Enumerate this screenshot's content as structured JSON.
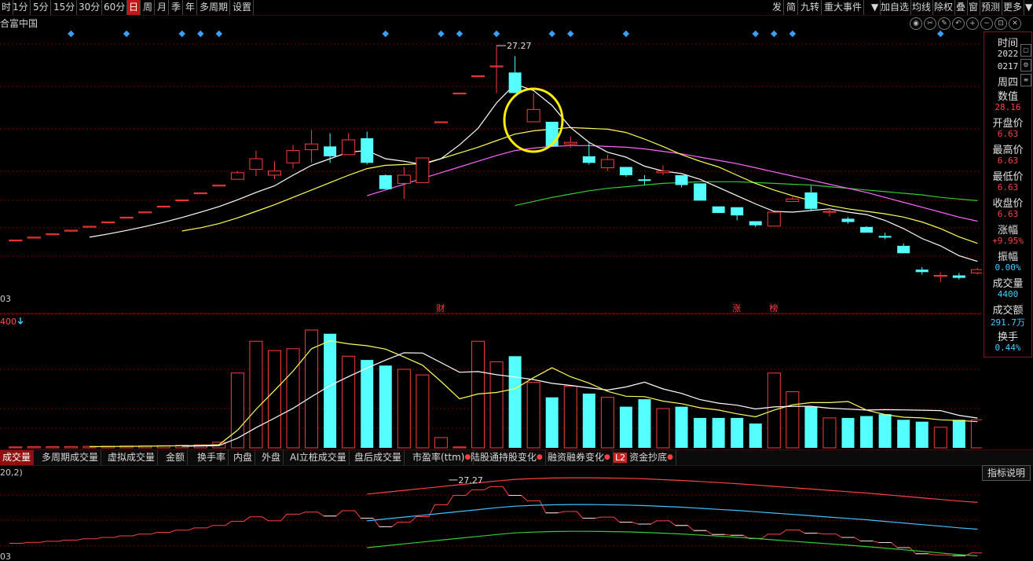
{
  "toolbar": {
    "left_items": [
      "时",
      "1分",
      "5分",
      "15分",
      "30分",
      "60分",
      "日",
      "周",
      "月",
      "季",
      "年",
      "多周期",
      "设置"
    ],
    "active_left": "日",
    "right_items": [
      "发",
      "简",
      "九转",
      "重大事件",
      "▼",
      "加自选",
      "均线",
      "除权",
      "叠",
      "窗",
      "预测",
      "更多",
      "▼"
    ]
  },
  "title": "合富中国",
  "chart": {
    "price_label": "27.27",
    "left_axis_bottom": "03",
    "event_markers": [
      "财",
      "涨",
      "榜"
    ],
    "volume_label": "400",
    "lower_label": "20,2)",
    "lower_price_label": "27.27",
    "lower_axis_bottom": "03"
  },
  "sidepanel": {
    "rows": [
      {
        "label": "时间",
        "value": null
      },
      {
        "label": null,
        "value": "2022",
        "style": "date"
      },
      {
        "label": null,
        "value": "0217",
        "style": "date"
      },
      {
        "label": "周四",
        "value": null
      },
      {
        "label": "数值",
        "value": null
      },
      {
        "label": null,
        "value": "28.16",
        "style": "red"
      },
      {
        "label": "开盘价",
        "value": null
      },
      {
        "label": null,
        "value": "6.63",
        "style": "red"
      },
      {
        "label": "最高价",
        "value": null
      },
      {
        "label": null,
        "value": "6.63",
        "style": "red"
      },
      {
        "label": "最低价",
        "value": null
      },
      {
        "label": null,
        "value": "6.63",
        "style": "red"
      },
      {
        "label": "收盘价",
        "value": null
      },
      {
        "label": null,
        "value": "6.63",
        "style": "red"
      },
      {
        "label": "涨幅",
        "value": null
      },
      {
        "label": null,
        "value": "+9.95%",
        "style": "red"
      },
      {
        "label": "振幅",
        "value": null
      },
      {
        "label": null,
        "value": "0.00%",
        "style": "cyan"
      },
      {
        "label": "成交量",
        "value": null
      },
      {
        "label": null,
        "value": "4400",
        "style": "cyan"
      },
      {
        "label": "成交额",
        "value": null
      },
      {
        "label": null,
        "value": "291.7万",
        "style": "cyan"
      },
      {
        "label": "换手",
        "value": null
      },
      {
        "label": null,
        "value": "0.44%",
        "style": "cyan"
      }
    ]
  },
  "tabs": [
    {
      "label": "成交量",
      "active": true,
      "dot": false
    },
    {
      "label": "多周期成交量",
      "active": false,
      "dot": false
    },
    {
      "label": "虚拟成交量",
      "active": false,
      "dot": false
    },
    {
      "label": "金额",
      "active": false,
      "dot": false
    },
    {
      "label": "换手率",
      "active": false,
      "dot": false
    },
    {
      "label": "内盘",
      "active": false,
      "dot": false
    },
    {
      "label": "外盘",
      "active": false,
      "dot": false
    },
    {
      "label": "AI立桩成交量",
      "active": false,
      "dot": false
    },
    {
      "label": "盘后成交量",
      "active": false,
      "dot": false
    },
    {
      "label": "市盈率(ttm)",
      "active": false,
      "dot": true
    },
    {
      "label": "陆股通持股变化",
      "active": false,
      "dot": true
    },
    {
      "label": "融资融券变化",
      "active": false,
      "dot": true
    },
    {
      "label": "资金抄底",
      "active": false,
      "dot": true,
      "badge": "L2"
    }
  ],
  "explain_button": "指标说明",
  "colors": {
    "up": "#ff3b3b",
    "down": "#54ffff",
    "ma5": "#ffffff",
    "ma10": "#ffff55",
    "ma20": "#ff66ff",
    "ma60": "#33cc33",
    "grid": "#7a0000",
    "highlight": "#ffee00"
  },
  "candles": [
    {
      "o": 3.6,
      "c": 3.6,
      "h": 3.6,
      "l": 3.6
    },
    {
      "o": 3.96,
      "c": 3.96,
      "h": 3.96,
      "l": 3.96
    },
    {
      "o": 4.36,
      "c": 4.36,
      "h": 4.36,
      "l": 4.36
    },
    {
      "o": 4.8,
      "c": 4.8,
      "h": 4.8,
      "l": 4.8
    },
    {
      "o": 5.28,
      "c": 5.28,
      "h": 5.28,
      "l": 5.28
    },
    {
      "o": 5.81,
      "c": 5.81,
      "h": 5.81,
      "l": 5.81
    },
    {
      "o": 6.39,
      "c": 6.39,
      "h": 6.39,
      "l": 6.39
    },
    {
      "o": 7.03,
      "c": 7.03,
      "h": 7.03,
      "l": 7.03
    },
    {
      "o": 7.73,
      "c": 7.73,
      "h": 7.73,
      "l": 7.73
    },
    {
      "o": 8.5,
      "c": 8.5,
      "h": 8.5,
      "l": 8.5
    },
    {
      "o": 9.35,
      "c": 9.35,
      "h": 9.35,
      "l": 9.35
    },
    {
      "o": 10.29,
      "c": 10.29,
      "h": 10.29,
      "l": 10.29
    },
    {
      "o": 11.0,
      "c": 11.8,
      "h": 12.0,
      "l": 11.0
    },
    {
      "o": 12.2,
      "c": 13.5,
      "h": 14.5,
      "l": 11.4
    },
    {
      "o": 11.5,
      "c": 12.0,
      "h": 13.2,
      "l": 11.0
    },
    {
      "o": 13.0,
      "c": 14.5,
      "h": 15.2,
      "l": 12.3
    },
    {
      "o": 14.6,
      "c": 15.3,
      "h": 17.0,
      "l": 13.0
    },
    {
      "o": 15.0,
      "c": 13.8,
      "h": 16.6,
      "l": 13.0
    },
    {
      "o": 14.0,
      "c": 15.8,
      "h": 16.6,
      "l": 14.0
    },
    {
      "o": 16.0,
      "c": 13.0,
      "h": 16.8,
      "l": 12.8
    },
    {
      "o": 11.5,
      "c": 9.8,
      "h": 11.6,
      "l": 9.8
    },
    {
      "o": 10.5,
      "c": 11.5,
      "h": 12.5,
      "l": 8.6
    },
    {
      "o": 10.6,
      "c": 13.6,
      "h": 13.6,
      "l": 10.6
    },
    {
      "o": 18.0,
      "c": 18.0,
      "h": 18.0,
      "l": 18.0
    },
    {
      "o": 21.5,
      "c": 21.5,
      "h": 21.5,
      "l": 21.5
    },
    {
      "o": 23.6,
      "c": 23.6,
      "h": 23.6,
      "l": 23.6
    },
    {
      "o": 24.8,
      "c": 24.8,
      "h": 27.27,
      "l": 21.5
    },
    {
      "o": 24.0,
      "c": 21.5,
      "h": 26.0,
      "l": 21.5
    },
    {
      "o": 18.0,
      "c": 19.5,
      "h": 21.5,
      "l": 18.0
    },
    {
      "o": 18.0,
      "c": 15.0,
      "h": 18.0,
      "l": 15.0
    },
    {
      "o": 15.3,
      "c": 15.5,
      "h": 16.2,
      "l": 14.8
    },
    {
      "o": 13.8,
      "c": 13.0,
      "h": 15.5,
      "l": 12.8
    },
    {
      "o": 12.4,
      "c": 13.4,
      "h": 14.0,
      "l": 12.0
    },
    {
      "o": 12.5,
      "c": 11.5,
      "h": 12.5,
      "l": 11.3
    },
    {
      "o": 11.0,
      "c": 10.8,
      "h": 11.5,
      "l": 10.3
    },
    {
      "o": 11.8,
      "c": 12.0,
      "h": 12.7,
      "l": 11.5
    },
    {
      "o": 11.5,
      "c": 10.3,
      "h": 11.5,
      "l": 10.0
    },
    {
      "o": 10.5,
      "c": 8.4,
      "h": 10.5,
      "l": 8.4
    },
    {
      "o": 7.7,
      "c": 6.9,
      "h": 7.7,
      "l": 6.9
    },
    {
      "o": 7.6,
      "c": 6.6,
      "h": 7.6,
      "l": 6.0
    },
    {
      "o": 5.9,
      "c": 5.4,
      "h": 5.9,
      "l": 5.2
    },
    {
      "o": 5.3,
      "c": 7.0,
      "h": 7.0,
      "l": 5.3
    },
    {
      "o": 8.3,
      "c": 8.6,
      "h": 9.0,
      "l": 8.3
    },
    {
      "o": 9.4,
      "c": 7.4,
      "h": 10.2,
      "l": 7.2
    },
    {
      "o": 7.1,
      "c": 7.1,
      "h": 7.4,
      "l": 6.5
    },
    {
      "o": 6.2,
      "c": 5.8,
      "h": 6.4,
      "l": 5.6
    },
    {
      "o": 5.2,
      "c": 4.5,
      "h": 5.3,
      "l": 4.5
    },
    {
      "o": 4.1,
      "c": 3.9,
      "h": 4.5,
      "l": 3.7
    },
    {
      "o": 2.9,
      "c": 2.0,
      "h": 3.2,
      "l": 2.0
    },
    {
      "o": 0.0,
      "c": -0.3,
      "h": 0.3,
      "l": -0.6
    },
    {
      "o": -0.7,
      "c": -0.7,
      "h": -0.3,
      "l": -1.5
    },
    {
      "o": -0.7,
      "c": -1.0,
      "h": -0.4,
      "l": -1.2
    },
    {
      "o": -0.4,
      "c": 0.0,
      "h": 0.2,
      "l": -0.6
    }
  ],
  "volumes": [
    0.5,
    0.6,
    0.6,
    0.7,
    0.8,
    0.9,
    1.0,
    1.1,
    1.2,
    1.4,
    1.6,
    3.0,
    40.0,
    57.0,
    52.0,
    53.0,
    63.0,
    61.0,
    49.0,
    47.0,
    44.0,
    42.0,
    39.0,
    5.5,
    0.5,
    57.0,
    46.0,
    49.0,
    35.0,
    27.0,
    33.0,
    29.0,
    27.0,
    22.0,
    26.0,
    21.0,
    22.0,
    16.0,
    16.0,
    16.0,
    13.0,
    40.0,
    30.0,
    22.0,
    16.0,
    16.0,
    17.0,
    18.0,
    15.0,
    14.0,
    11.0,
    15.0,
    15.0
  ],
  "ma_lines": {
    "ma5": [
      null,
      null,
      null,
      null,
      3.95,
      4.34,
      4.77,
      5.25,
      5.77,
      6.35,
      6.99,
      7.68,
      8.5,
      9.4,
      10.2,
      11.5,
      12.7,
      13.5,
      14.3,
      14.5,
      13.5,
      13.2,
      12.8,
      13.5,
      15.2,
      17.2,
      20.3,
      22.6,
      21.8,
      20.0,
      17.3,
      15.5,
      14.3,
      13.7,
      12.6,
      12.0,
      11.7,
      11.0,
      10.0,
      9.0,
      8.0,
      7.1,
      7.0,
      7.2,
      7.4,
      7.0,
      6.7,
      6.0,
      5.0,
      3.8,
      2.9,
      1.7,
      1.0
    ],
    "ma10": [
      null,
      null,
      null,
      null,
      null,
      null,
      null,
      null,
      null,
      4.7,
      5.1,
      5.6,
      6.3,
      7.1,
      7.9,
      8.8,
      9.7,
      10.6,
      11.5,
      12.3,
      12.7,
      12.8,
      12.9,
      13.5,
      14.2,
      14.9,
      15.7,
      16.5,
      16.9,
      17.1,
      17.3,
      17.2,
      17.1,
      16.7,
      15.9,
      15.0,
      14.0,
      13.2,
      12.5,
      11.5,
      10.5,
      9.7,
      9.0,
      8.4,
      7.8,
      7.4,
      7.1,
      6.8,
      6.4,
      5.8,
      5.0,
      4.0,
      3.2
    ],
    "ma20": [
      null,
      null,
      null,
      null,
      null,
      null,
      null,
      null,
      null,
      null,
      null,
      null,
      null,
      null,
      null,
      null,
      null,
      null,
      null,
      9.0,
      9.7,
      10.4,
      11.1,
      11.8,
      12.5,
      13.2,
      13.9,
      14.5,
      14.8,
      15.0,
      15.1,
      15.1,
      15.0,
      14.9,
      14.7,
      14.4,
      14.1,
      13.7,
      13.3,
      12.9,
      12.4,
      11.9,
      11.4,
      10.9,
      10.4,
      9.9,
      9.4,
      8.8,
      8.2,
      7.6,
      7.0,
      6.4,
      5.9
    ],
    "ma60": [
      null,
      null,
      null,
      null,
      null,
      null,
      null,
      null,
      null,
      null,
      null,
      null,
      null,
      null,
      null,
      null,
      null,
      null,
      null,
      null,
      null,
      null,
      null,
      null,
      null,
      null,
      null,
      7.8,
      8.3,
      8.8,
      9.2,
      9.6,
      9.9,
      10.1,
      10.3,
      10.5,
      10.6,
      10.7,
      10.7,
      10.7,
      10.6,
      10.5,
      10.4,
      10.3,
      10.1,
      9.9,
      9.7,
      9.5,
      9.3,
      9.1,
      8.8,
      8.6,
      8.4
    ]
  }
}
